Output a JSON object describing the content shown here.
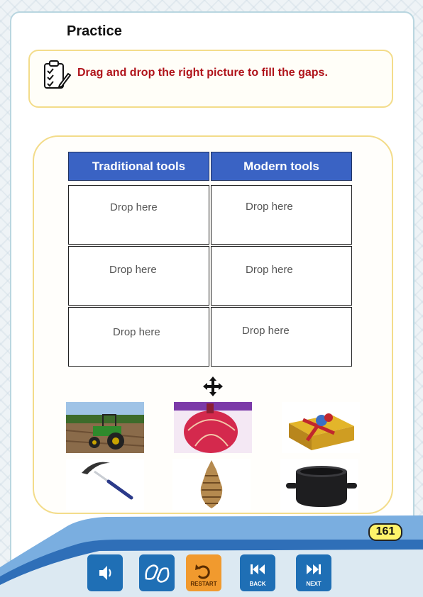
{
  "page": {
    "title": "Practice",
    "instruction": "Drag and drop the right picture to fill the gaps."
  },
  "table": {
    "headers": [
      "Traditional tools",
      "Modern tools"
    ],
    "cells": [
      "Drop here",
      "Drop here",
      "Drop here",
      "Drop here",
      "Drop here",
      "Drop here"
    ]
  },
  "pictures": [
    {
      "name": "tractor-picture"
    },
    {
      "name": "gourd-picture"
    },
    {
      "name": "gift-box-picture"
    },
    {
      "name": "sickle-picture"
    },
    {
      "name": "woven-basket-picture"
    },
    {
      "name": "cooking-pot-picture"
    }
  ],
  "footer": {
    "page_number": "161",
    "restart_label": "RESTART",
    "back_label": "BACK",
    "next_label": "NEXT"
  },
  "colors": {
    "header_blue": "#3a63c4",
    "instruction_red": "#b0141b",
    "accent_yellow": "#f3dc8a",
    "button_blue": "#1f6fb5",
    "restart_orange": "#f19a2e"
  }
}
